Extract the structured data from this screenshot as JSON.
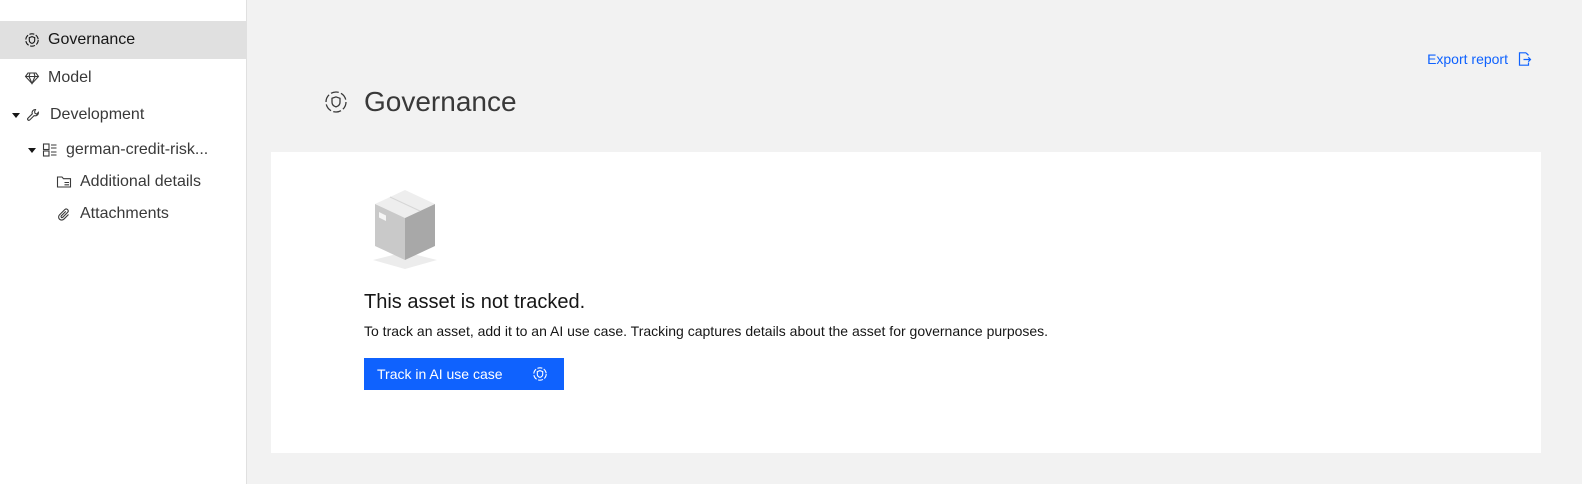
{
  "sidebar": {
    "items": [
      {
        "label": "Governance",
        "icon": "governance-icon",
        "active": true
      },
      {
        "label": "Model",
        "icon": "diamond-icon"
      },
      {
        "label": "Development",
        "icon": "wrench-icon",
        "expanded": true
      },
      {
        "label": "german-credit-risk...",
        "icon": "model-asset-icon",
        "expanded": true
      },
      {
        "label": "Additional details",
        "icon": "folder-details-icon"
      },
      {
        "label": "Attachments",
        "icon": "paperclip-icon"
      }
    ]
  },
  "header": {
    "title": "Governance",
    "export_label": "Export report"
  },
  "empty_state": {
    "title": "This asset is not tracked.",
    "description": "To track an asset, add it to an AI use case. Tracking captures details about the asset for governance purposes.",
    "button_label": "Track in AI use case"
  },
  "colors": {
    "accent": "#0f62fe",
    "active_bg": "#e0e0e0",
    "page_bg": "#f2f2f2"
  }
}
